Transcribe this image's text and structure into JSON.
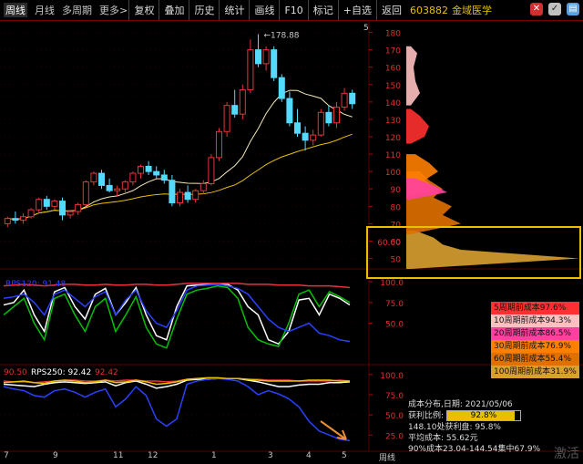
{
  "toolbar": {
    "left": [
      "周线",
      "月线",
      "多周期",
      "更多>"
    ],
    "right": [
      "复权",
      "叠加",
      "历史",
      "统计",
      "画线",
      "F10",
      "标记",
      "+自选",
      "返回"
    ]
  },
  "stock": {
    "code": "603882",
    "name": "金域医学"
  },
  "colors": {
    "up": "#e8333a",
    "down": "#54d9ff",
    "ma1": "#f3e9b6",
    "ma2": "#e8c000",
    "grid": "#5a0000"
  },
  "chart_data": [
    {
      "type": "candlestick",
      "title": "",
      "peak_label": "178.88",
      "y_ticks": [
        50,
        60,
        70,
        80,
        90,
        100,
        110,
        120,
        130,
        140,
        150,
        160,
        170,
        180
      ],
      "ylim": [
        44,
        185
      ],
      "x_ticks": [
        "7",
        "9",
        "11",
        "1",
        "3",
        "5"
      ],
      "right_tick": "5",
      "candles": [
        {
          "o": 70,
          "h": 74,
          "l": 68,
          "c": 73
        },
        {
          "o": 73,
          "h": 77,
          "l": 70,
          "c": 72
        },
        {
          "o": 72,
          "h": 76,
          "l": 70,
          "c": 74
        },
        {
          "o": 74,
          "h": 79,
          "l": 73,
          "c": 78
        },
        {
          "o": 78,
          "h": 85,
          "l": 76,
          "c": 84
        },
        {
          "o": 84,
          "h": 86,
          "l": 78,
          "c": 80
        },
        {
          "o": 80,
          "h": 84,
          "l": 78,
          "c": 83
        },
        {
          "o": 83,
          "h": 85,
          "l": 72,
          "c": 75
        },
        {
          "o": 75,
          "h": 78,
          "l": 73,
          "c": 77
        },
        {
          "o": 77,
          "h": 82,
          "l": 75,
          "c": 81
        },
        {
          "o": 81,
          "h": 95,
          "l": 80,
          "c": 94
        },
        {
          "o": 94,
          "h": 100,
          "l": 92,
          "c": 99
        },
        {
          "o": 99,
          "h": 101,
          "l": 90,
          "c": 92
        },
        {
          "o": 92,
          "h": 96,
          "l": 88,
          "c": 89
        },
        {
          "o": 89,
          "h": 92,
          "l": 86,
          "c": 90
        },
        {
          "o": 90,
          "h": 95,
          "l": 88,
          "c": 94
        },
        {
          "o": 94,
          "h": 100,
          "l": 92,
          "c": 99
        },
        {
          "o": 99,
          "h": 104,
          "l": 96,
          "c": 103
        },
        {
          "o": 103,
          "h": 106,
          "l": 98,
          "c": 100
        },
        {
          "o": 100,
          "h": 103,
          "l": 96,
          "c": 98
        },
        {
          "o": 98,
          "h": 101,
          "l": 93,
          "c": 95
        },
        {
          "o": 95,
          "h": 98,
          "l": 80,
          "c": 82
        },
        {
          "o": 82,
          "h": 90,
          "l": 80,
          "c": 88
        },
        {
          "o": 88,
          "h": 92,
          "l": 82,
          "c": 84
        },
        {
          "o": 84,
          "h": 90,
          "l": 82,
          "c": 89
        },
        {
          "o": 89,
          "h": 95,
          "l": 87,
          "c": 93
        },
        {
          "o": 93,
          "h": 110,
          "l": 92,
          "c": 108
        },
        {
          "o": 108,
          "h": 125,
          "l": 106,
          "c": 123
        },
        {
          "o": 123,
          "h": 140,
          "l": 120,
          "c": 138
        },
        {
          "o": 138,
          "h": 147,
          "l": 131,
          "c": 133
        },
        {
          "o": 133,
          "h": 150,
          "l": 130,
          "c": 147
        },
        {
          "o": 147,
          "h": 176,
          "l": 145,
          "c": 170
        },
        {
          "o": 170,
          "h": 179,
          "l": 160,
          "c": 162
        },
        {
          "o": 162,
          "h": 172,
          "l": 158,
          "c": 170
        },
        {
          "o": 170,
          "h": 172,
          "l": 152,
          "c": 154
        },
        {
          "o": 154,
          "h": 156,
          "l": 140,
          "c": 142
        },
        {
          "o": 142,
          "h": 146,
          "l": 126,
          "c": 128
        },
        {
          "o": 128,
          "h": 136,
          "l": 120,
          "c": 122
        },
        {
          "o": 122,
          "h": 126,
          "l": 112,
          "c": 118
        },
        {
          "o": 118,
          "h": 124,
          "l": 115,
          "c": 121
        },
        {
          "o": 121,
          "h": 136,
          "l": 120,
          "c": 134
        },
        {
          "o": 134,
          "h": 138,
          "l": 126,
          "c": 128
        },
        {
          "o": 128,
          "h": 140,
          "l": 125,
          "c": 137
        },
        {
          "o": 137,
          "h": 148,
          "l": 135,
          "c": 145
        },
        {
          "o": 145,
          "h": 147,
          "l": 136,
          "c": 139
        }
      ]
    },
    {
      "type": "line",
      "title": "RPS",
      "label": "RPS120: 91.48",
      "y_ticks": [
        50,
        75,
        100
      ],
      "ylim": [
        0,
        110
      ],
      "series": [
        {
          "name": "RPS120",
          "color": "#ffffff",
          "values": [
            72,
            75,
            90,
            60,
            40,
            88,
            93,
            70,
            55,
            85,
            92,
            60,
            75,
            93,
            60,
            35,
            30,
            70,
            95,
            96,
            97,
            97,
            97,
            90,
            70,
            60,
            30,
            25,
            40,
            78,
            80,
            60,
            85,
            80,
            72
          ]
        },
        {
          "name": "RPS50",
          "color": "#00c000",
          "values": [
            60,
            70,
            80,
            50,
            30,
            80,
            85,
            60,
            40,
            70,
            80,
            40,
            60,
            82,
            45,
            25,
            20,
            55,
            85,
            90,
            92,
            95,
            93,
            80,
            45,
            30,
            25,
            22,
            50,
            85,
            90,
            70,
            88,
            82,
            75
          ]
        },
        {
          "name": "RPS250",
          "color": "#2a40ff",
          "values": [
            80,
            82,
            85,
            75,
            60,
            85,
            90,
            80,
            70,
            82,
            88,
            60,
            78,
            90,
            65,
            50,
            45,
            65,
            90,
            95,
            96,
            97,
            95,
            92,
            85,
            70,
            55,
            45,
            40,
            45,
            50,
            38,
            35,
            30,
            28
          ]
        },
        {
          "name": "RPS10",
          "color": "#e8333a",
          "values": [
            95,
            96,
            97,
            96,
            95,
            96,
            97,
            97,
            96,
            96,
            97,
            96,
            96,
            97,
            97,
            96,
            96,
            97,
            98,
            98,
            98,
            98,
            98,
            98,
            97,
            97,
            97,
            96,
            96,
            96,
            95,
            95,
            95,
            94,
            93
          ]
        }
      ]
    },
    {
      "type": "line",
      "title": "RPS",
      "label": "RPS250: 92.42",
      "extra_label": "92.42",
      "left_label": "90.50",
      "y_ticks": [
        25,
        50,
        75,
        100
      ],
      "ylim": [
        5,
        110
      ],
      "series": [
        {
          "name": "RPS250",
          "color": "#e8333a",
          "values": [
            92,
            91,
            91,
            90,
            91,
            92,
            93,
            93,
            92,
            92,
            93,
            92,
            93,
            93,
            92,
            92,
            91,
            92,
            94,
            95,
            95,
            95,
            95,
            95,
            94,
            94,
            93,
            93,
            93,
            92,
            92,
            92,
            92,
            93,
            92
          ]
        },
        {
          "name": "RPS120",
          "color": "#ffffff",
          "values": [
            88,
            87,
            86,
            85,
            88,
            90,
            91,
            90,
            89,
            90,
            91,
            86,
            90,
            92,
            88,
            83,
            85,
            88,
            93,
            94,
            94,
            95,
            95,
            95,
            93,
            91,
            88,
            85,
            85,
            87,
            88,
            88,
            90,
            90,
            91
          ]
        },
        {
          "name": "RPS50",
          "color": "#2a40ff",
          "values": [
            85,
            82,
            80,
            74,
            72,
            80,
            82,
            78,
            72,
            78,
            82,
            60,
            70,
            85,
            74,
            45,
            36,
            45,
            88,
            92,
            94,
            95,
            94,
            92,
            85,
            75,
            80,
            76,
            70,
            60,
            42,
            30,
            25,
            20,
            18
          ]
        },
        {
          "name": "RPS10",
          "color": "#e8c000",
          "values": [
            90,
            91,
            92,
            90,
            89,
            92,
            93,
            92,
            90,
            91,
            93,
            90,
            91,
            93,
            91,
            88,
            89,
            91,
            94,
            95,
            96,
            96,
            95,
            95,
            94,
            93,
            92,
            92,
            92,
            92,
            93,
            93,
            93,
            92,
            92
          ]
        }
      ]
    }
  ],
  "cost_distribution": {
    "date_label": "成本分布,日期:",
    "date": "2021/05/06",
    "profit_label": "获利比例:",
    "profit_ratio": 92.8,
    "profit_text": "92.8%",
    "line1": "148.10处获利盘: 95.8%",
    "line2": "平均成本: 55.62元",
    "line3": "90%成本23.04-144.54集中67.9%",
    "legend": [
      {
        "label": "5周期前成本97.6%",
        "color": "#ff3030"
      },
      {
        "label": "10周期前成本94.3%",
        "color": "#ffc0c0"
      },
      {
        "label": "20周期前成本86.5%",
        "color": "#ff40a0"
      },
      {
        "label": "30周期前成本76.9%",
        "color": "#ff8000"
      },
      {
        "label": "60周期前成本55.4%",
        "color": "#e07000"
      },
      {
        "label": "100周期前成本31.9%",
        "color": "#d9a030"
      }
    ],
    "ticks": [
      60,
      70,
      80,
      90,
      100,
      110,
      120,
      130,
      140,
      150,
      160,
      170,
      180
    ],
    "bottom_label": "周线"
  },
  "watermark": "激活"
}
